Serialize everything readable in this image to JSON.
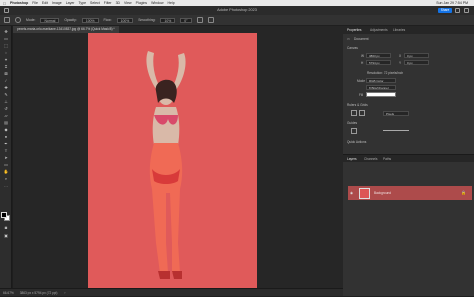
{
  "menubar": {
    "apple": "",
    "items": [
      "Photoshop",
      "File",
      "Edit",
      "Image",
      "Layer",
      "Type",
      "Select",
      "Filter",
      "3D",
      "View",
      "Plugins",
      "Window",
      "Help"
    ],
    "clock": "Sun Jan 29 7:54 PM"
  },
  "titlebar": {
    "title": "Adobe Photoshop 2023",
    "share_label": "Share"
  },
  "options": {
    "mode_label": "Mode:",
    "mode_value": "Normal",
    "opacity_label": "Opacity:",
    "opacity_value": "100%",
    "flow_label": "Flow:",
    "flow_value": "100%",
    "smoothing_label": "Smoothing:",
    "smoothing_value": "10%",
    "angle_value": "0°"
  },
  "document_tab": {
    "label": "pexels-maria-orlo-marikane-13410837.jpg @ 66.7% (Quick Mask/8) *"
  },
  "status": {
    "zoom": "66.67%",
    "size": "3863 px x 5794 px (72 ppi)"
  },
  "panel_tabs": {
    "properties": "Properties",
    "adjustments": "Adjustments",
    "libraries": "Libraries"
  },
  "properties": {
    "doc_label": "Document",
    "canvas_header": "Canvas",
    "w_label": "W",
    "w_value": "3863 px",
    "h_label": "H",
    "h_value": "5794 px",
    "x_label": "X",
    "x_value": "0 px",
    "y_label": "Y",
    "y_value": "0 px",
    "resolution": "Resolution: 72 pixels/inch",
    "mode_label": "Mode",
    "mode_value": "RGB Color",
    "bits_value": "8 Bits/Channel",
    "fill_label": "Fill",
    "rulers_header": "Rulers & Grids",
    "units_value": "Pixels",
    "guides_header": "Guides",
    "quick_actions_header": "Quick Actions"
  },
  "layers_tabs": {
    "layers": "Layers",
    "channels": "Channels",
    "paths": "Paths"
  },
  "layers": {
    "items": [
      {
        "name": "Background",
        "locked": true,
        "visible": true
      }
    ]
  },
  "colors": {
    "accent": "#1473e6",
    "canvas_red": "#e05a5a",
    "layer_row_selected": "#ad4b4b"
  }
}
